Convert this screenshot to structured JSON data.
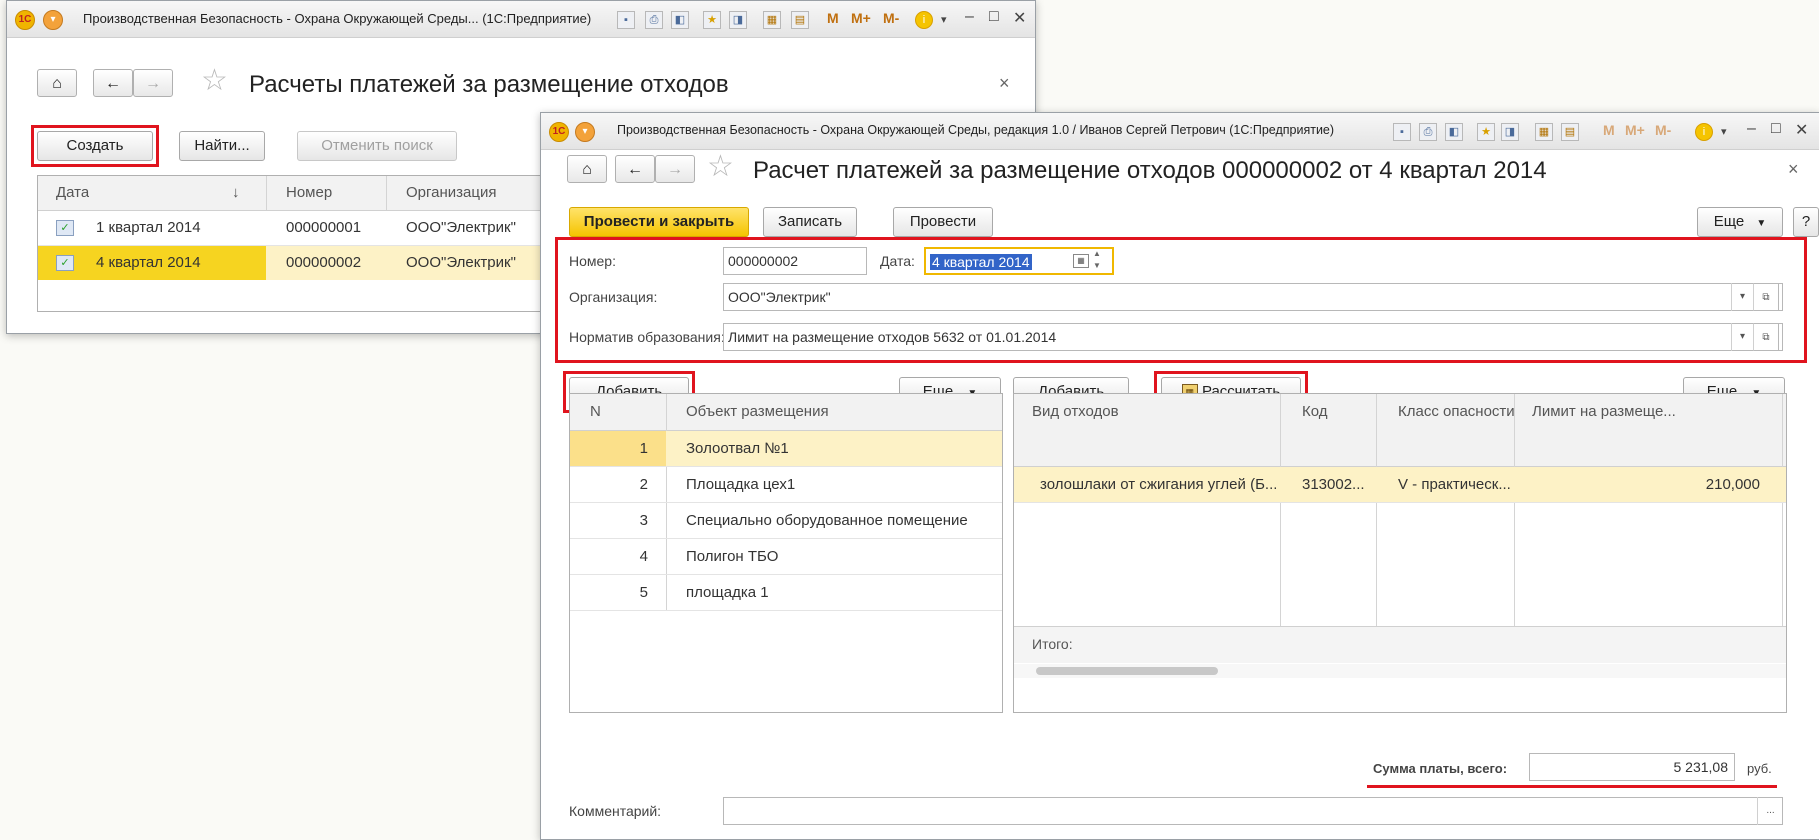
{
  "window1": {
    "title": "Производственная Безопасность - Охрана Окружающей Среды... (1С:Предприятие)",
    "toolbar_text": [
      "M",
      "M+",
      "M-"
    ],
    "form_title": "Расчеты платежей за размещение отходов",
    "buttons": {
      "create": "Создать",
      "find": "Найти...",
      "cancel_search": "Отменить поиск"
    },
    "columns": {
      "date": "Дата",
      "sort_arrow": "↓",
      "number": "Номер",
      "org": "Организация"
    },
    "rows": [
      {
        "date": "1 квартал 2014",
        "number": "000000001",
        "org": "ООО\"Электрик\""
      },
      {
        "date": "4 квартал 2014",
        "number": "000000002",
        "org": "ООО\"Электрик\""
      }
    ]
  },
  "window2": {
    "title": "Производственная Безопасность - Охрана Окружающей Среды, редакция 1.0 / Иванов Сергей Петрович (1С:Предприятие)",
    "toolbar_text": [
      "M",
      "M+",
      "M-"
    ],
    "form_title": "Расчет платежей за размещение отходов 000000002 от 4 квартал 2014",
    "buttons": {
      "post_close": "Провести и закрыть",
      "save": "Записать",
      "post": "Провести",
      "more": "Еще",
      "help": "?"
    },
    "fields": {
      "number_label": "Номер:",
      "number_value": "000000002",
      "date_label": "Дата:",
      "date_value": "4 квартал 2014",
      "org_label": "Организация:",
      "org_value": "ООО\"Электрик\"",
      "norm_label": "Норматив образования:",
      "norm_value": "Лимит на размещение отходов 5632 от 01.01.2014"
    },
    "left_panel": {
      "add": "Добавить",
      "more": "Еще",
      "col_n": "N",
      "col_object": "Объект размещения",
      "rows": [
        {
          "n": "1",
          "name": "Золоотвал №1"
        },
        {
          "n": "2",
          "name": "Площадка цех1"
        },
        {
          "n": "3",
          "name": "Специально оборудованное помещение"
        },
        {
          "n": "4",
          "name": "Полигон  ТБО"
        },
        {
          "n": "5",
          "name": "площадка 1"
        }
      ]
    },
    "right_panel": {
      "add": "Добавить",
      "calculate": "Рассчитать",
      "more": "Еще",
      "columns": {
        "waste_type": "Вид отходов",
        "code": "Код",
        "hazard": "Класс опасности",
        "limit": "Лимит на размеще..."
      },
      "rows": [
        {
          "waste_type": "золошлаки от сжигания углей (Б...",
          "code": "313002...",
          "hazard": "V - практическ...",
          "limit": "210,000"
        }
      ],
      "total_label": "Итого:"
    },
    "total": {
      "label": "Сумма платы, всего:",
      "value": "5 231,08",
      "unit": "руб."
    },
    "comment": {
      "label": "Комментарий:",
      "value": "",
      "btn": "..."
    }
  }
}
